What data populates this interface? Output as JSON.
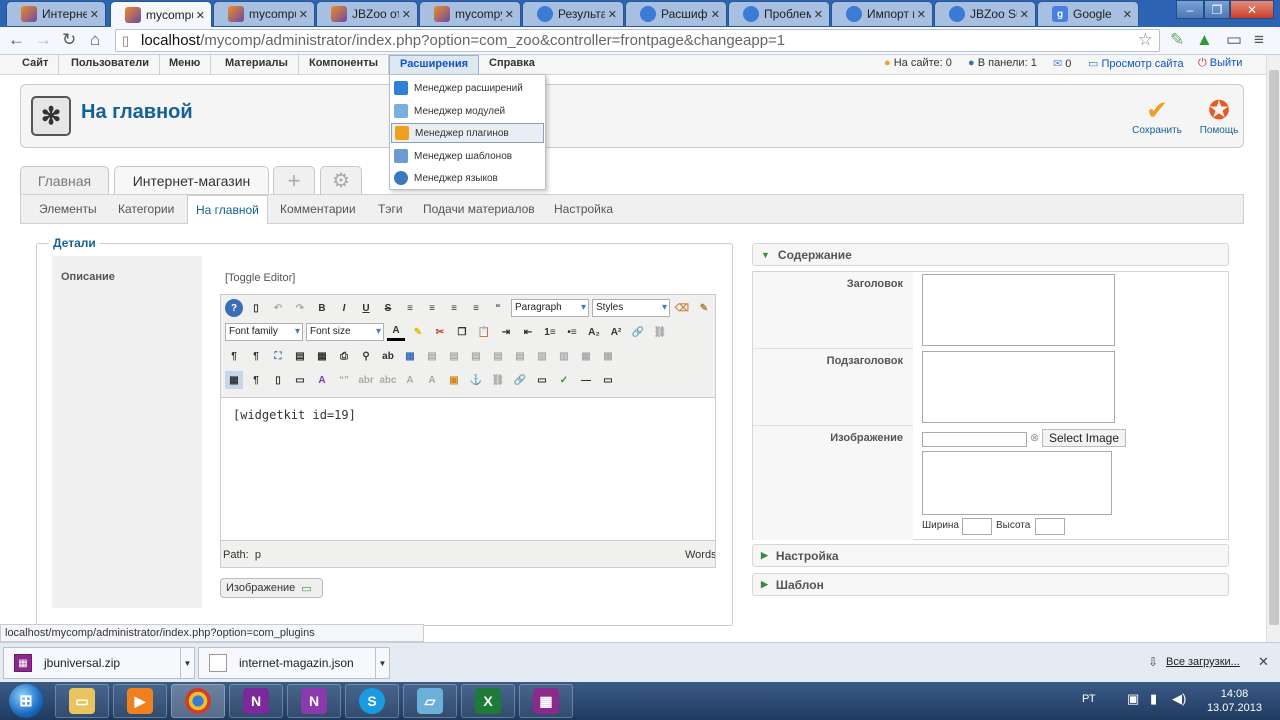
{
  "browser": {
    "tabs": [
      {
        "title": "Интерне",
        "icon": "jbzoo-icon",
        "active": false
      },
      {
        "title": "mycompu",
        "icon": "jbzoo-icon",
        "active": true
      },
      {
        "title": "mycompu",
        "icon": "jbzoo-icon",
        "active": false
      },
      {
        "title": "JBZoo от J",
        "icon": "jbzoo-icon",
        "active": false
      },
      {
        "title": "mycompy",
        "icon": "jbzoo-icon",
        "active": false
      },
      {
        "title": "Результат",
        "icon": "globe-icon",
        "active": false
      },
      {
        "title": "Расшифр",
        "icon": "globe-icon",
        "active": false
      },
      {
        "title": "Проблем",
        "icon": "globe-icon",
        "active": false
      },
      {
        "title": "Импорт к",
        "icon": "globe-icon",
        "active": false
      },
      {
        "title": "JBZoo Sup",
        "icon": "globe-icon",
        "active": false
      },
      {
        "title": "Google",
        "icon": "google-icon",
        "active": false
      }
    ],
    "url_host": "localhost",
    "url_rest": "/mycomp/administrator/index.php?option=com_zoo&controller=frontpage&changeapp=1",
    "status_url": "localhost/mycomp/administrator/index.php?option=com_plugins"
  },
  "admin_menu": {
    "items": [
      "Сайт",
      "Пользователи",
      "Меню",
      "Материалы",
      "Компоненты",
      "Расширения",
      "Справка"
    ],
    "open_item": "Расширения",
    "status": {
      "on_site": "На сайте: 0",
      "in_panel": "В панели: 1",
      "messages": "0",
      "view_site": "Просмотр сайта",
      "logout": "Выйти"
    }
  },
  "dropdown": {
    "items": [
      {
        "label": "Менеджер расширений",
        "icon": "extension-manager-icon",
        "color": "#2f7fd6"
      },
      {
        "label": "Менеджер модулей",
        "icon": "module-manager-icon",
        "color": "#7ab0de"
      },
      {
        "label": "Менеджер плагинов",
        "icon": "plugin-manager-icon",
        "color": "#f0a020",
        "highlighted": true
      },
      {
        "label": "Менеджер шаблонов",
        "icon": "template-manager-icon",
        "color": "#6a9bd1"
      },
      {
        "label": "Менеджер языков",
        "icon": "language-manager-icon",
        "color": "#3a78c0"
      }
    ]
  },
  "header": {
    "title": "На главной",
    "save_label": "Сохранить",
    "help_label": "Помощь"
  },
  "zoo_tabs": {
    "items": [
      "Главная",
      "Интернет-магазин"
    ],
    "active": "Интернет-магазин"
  },
  "subnav": {
    "items": [
      "Элементы",
      "Категории",
      "На главной",
      "Комментарии",
      "Тэги",
      "Подачи материалов",
      "Настройка"
    ],
    "active": "На главной"
  },
  "details": {
    "legend": "Детали",
    "description_label": "Описание",
    "toggle_editor": "[Toggle Editor]",
    "format_select": "Paragraph",
    "styles_select": "Styles",
    "font_family_select": "Font family",
    "font_size_select": "Font size",
    "content": "[widgetkit id=19]",
    "path_label": "Path:",
    "path_value": "p",
    "words_label": "Words",
    "image_button": "Изображение"
  },
  "right_panel": {
    "content_header": "Содержание",
    "title_label": "Заголовок",
    "subtitle_label": "Подзаголовок",
    "image_label": "Изображение",
    "select_image": "Select Image",
    "width_label": "Ширина",
    "height_label": "Высота",
    "settings_header": "Настройка",
    "template_header": "Шаблон"
  },
  "downloads": {
    "items": [
      {
        "name": "jbuniversal.zip",
        "icon": "archive-icon"
      },
      {
        "name": "internet-magazin.json",
        "icon": "file-icon"
      }
    ],
    "all_downloads": "Все загрузки..."
  },
  "taskbar": {
    "apps": [
      "explorer-icon",
      "media-player-icon",
      "chrome-icon",
      "onenote-icon",
      "onenote-quick-icon",
      "skype-icon",
      "notepad-icon",
      "excel-icon",
      "winrar-icon"
    ],
    "language": "РТ",
    "time": "14:08",
    "date": "13.07.2013"
  },
  "colors": {
    "accent": "#146295",
    "link": "#0b55c4",
    "tab_strip": "#2c63b3"
  }
}
